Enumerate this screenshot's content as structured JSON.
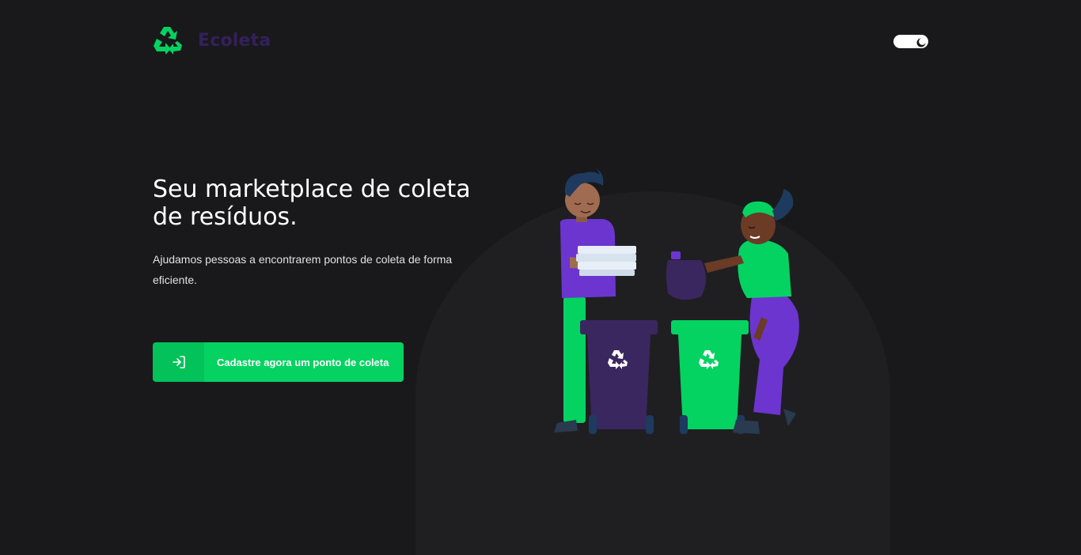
{
  "brand": {
    "name": "Ecoleta",
    "logo_icon": "recycle-icon"
  },
  "theme_toggle": {
    "icon": "moon-icon",
    "state": "dark"
  },
  "hero": {
    "title_line1": "Seu marketplace de coleta",
    "title_line2": "de resíduos.",
    "subtitle_line1": "Ajudamos pessoas a encontrarem pontos de coleta de forma",
    "subtitle_line2": "eficiente."
  },
  "cta": {
    "label": "Cadastre agora um ponto de coleta",
    "icon": "sign-in-icon"
  },
  "colors": {
    "background": "#19191b",
    "accent": "#04d361",
    "brand_purple": "#34205c",
    "illustration_purple": "#6c35d0"
  }
}
